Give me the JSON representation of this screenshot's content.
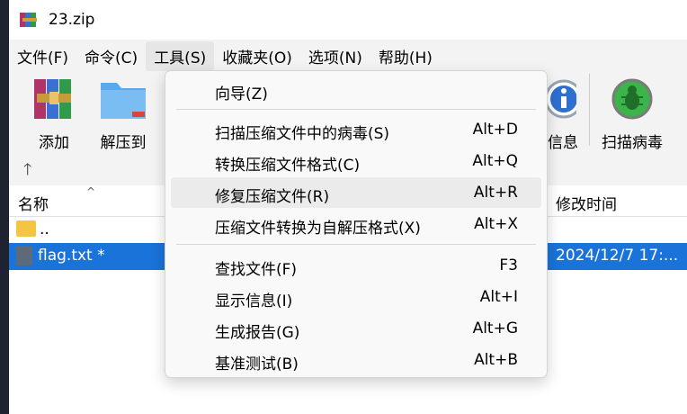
{
  "window": {
    "title": "23.zip"
  },
  "menubar": [
    {
      "label": "文件(F)"
    },
    {
      "label": "命令(C)"
    },
    {
      "label": "工具(S)"
    },
    {
      "label": "收藏夹(O)"
    },
    {
      "label": "选项(N)"
    },
    {
      "label": "帮助(H)"
    }
  ],
  "toolbar": {
    "add_label": "添加",
    "extract_label": "解压到",
    "info_label": "信息",
    "scan_label": "扫描病毒"
  },
  "columns": {
    "name": "名称",
    "modified": "修改时间"
  },
  "files": {
    "parent": "..",
    "file_name": "flag.txt *",
    "file_time": "2024/12/7 17:..."
  },
  "tools_menu": {
    "wizard": "向导(Z)",
    "items_group1": [
      {
        "label": "扫描压缩文件中的病毒(S)",
        "shortcut": "Alt+D"
      },
      {
        "label": "转换压缩文件格式(C)",
        "shortcut": "Alt+Q"
      },
      {
        "label": "修复压缩文件(R)",
        "shortcut": "Alt+R"
      },
      {
        "label": "压缩文件转换为自解压格式(X)",
        "shortcut": "Alt+X"
      }
    ],
    "items_group2": [
      {
        "label": "查找文件(F)",
        "shortcut": "F3"
      },
      {
        "label": "显示信息(I)",
        "shortcut": "Alt+I"
      },
      {
        "label": "生成报告(G)",
        "shortcut": "Alt+G"
      },
      {
        "label": "基准测试(B)",
        "shortcut": "Alt+B"
      }
    ]
  },
  "colors": {
    "selection": "#1a73d9",
    "accent_green": "#3bb54a"
  }
}
